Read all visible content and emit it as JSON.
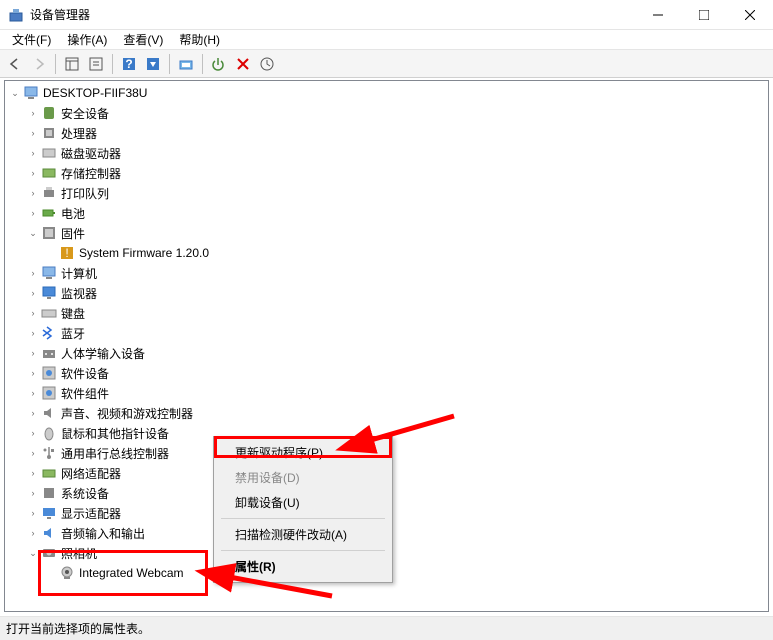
{
  "window": {
    "title": "设备管理器"
  },
  "menus": {
    "file": "文件(F)",
    "action": "操作(A)",
    "view": "查看(V)",
    "help": "帮助(H)"
  },
  "root": {
    "computer": "DESKTOP-FIIF38U"
  },
  "tree": {
    "security": "安全设备",
    "processor": "处理器",
    "disk": "磁盘驱动器",
    "storage": "存储控制器",
    "printq": "打印队列",
    "battery": "电池",
    "firmware": "固件",
    "firmware_item": "System Firmware 1.20.0",
    "computers": "计算机",
    "monitor": "监视器",
    "keyboard": "键盘",
    "bluetooth": "蓝牙",
    "hid": "人体学输入设备",
    "software_dev": "软件设备",
    "software_comp": "软件组件",
    "sound": "声音、视频和游戏控制器",
    "mouse": "鼠标和其他指针设备",
    "usb": "通用串行总线控制器",
    "network": "网络适配器",
    "system": "系统设备",
    "display": "显示适配器",
    "audio_io": "音频输入和输出",
    "camera": "照相机",
    "camera_item": "Integrated Webcam"
  },
  "context": {
    "update": "更新驱动程序(P)",
    "disable": "禁用设备(D)",
    "uninstall": "卸载设备(U)",
    "scan": "扫描检测硬件改动(A)",
    "properties": "属性(R)"
  },
  "status": "打开当前选择项的属性表。"
}
